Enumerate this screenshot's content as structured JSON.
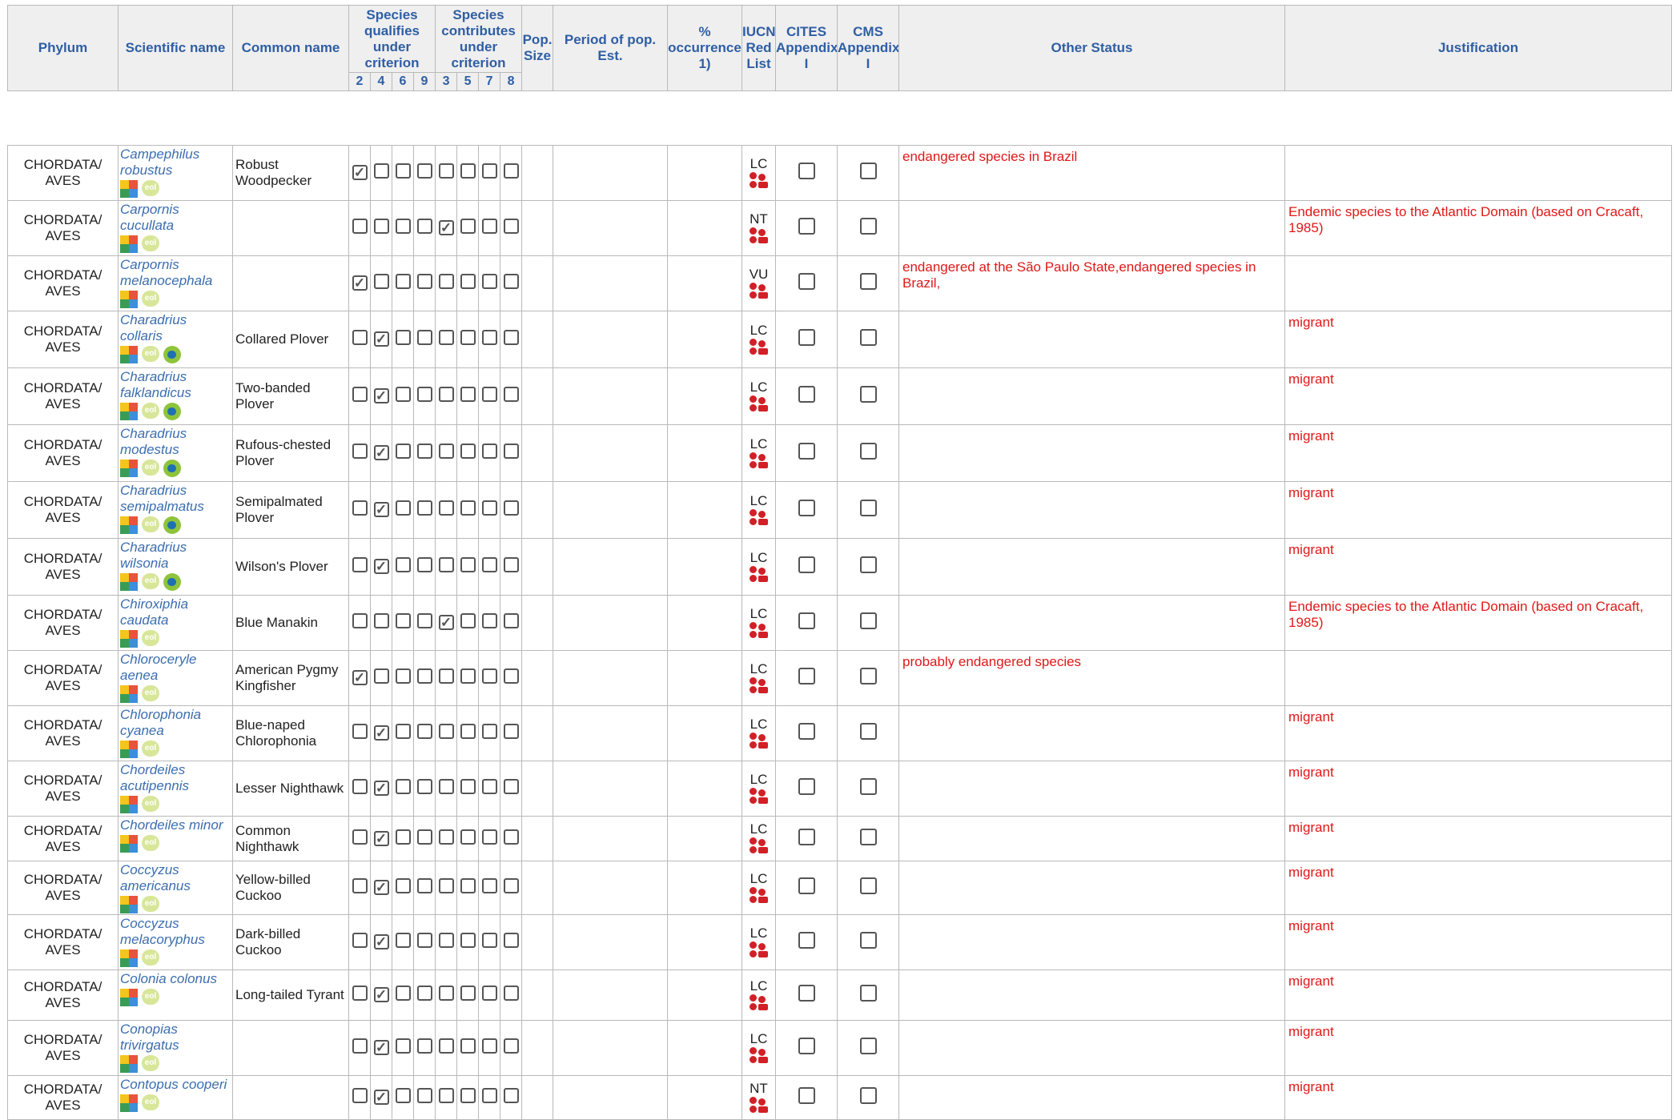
{
  "header": {
    "phylum": "Phylum",
    "scientific_name": "Scientific name",
    "common_name": "Common name",
    "qualifies": "Species qualifies under criterion",
    "contributes": "Species contributes under criterion",
    "pop_size": "Pop. Size",
    "period": "Period of pop. Est.",
    "occurrence": "% occurrence 1)",
    "iucn": "IUCN Red List",
    "cites": "CITES Appendix I",
    "cms": "CMS Appendix I",
    "other_status": "Other Status",
    "justification": "Justification",
    "qual_nums": [
      "2",
      "4",
      "6",
      "9"
    ],
    "contrib_nums": [
      "3",
      "5",
      "7",
      "8"
    ]
  },
  "rows": [
    {
      "phylum": "CHORDATA/ AVES",
      "sci": "Campephilus robustus",
      "common": "Robust Woodpecker",
      "checks": [
        1,
        0,
        0,
        0,
        0,
        0,
        0,
        0
      ],
      "iucn": "LC",
      "other": "endangered species in Brazil",
      "just": "",
      "bird": false
    },
    {
      "phylum": "CHORDATA/ AVES",
      "sci": "Carpornis cucullata",
      "common": "",
      "checks": [
        0,
        0,
        0,
        0,
        1,
        0,
        0,
        0
      ],
      "iucn": "NT",
      "other": "",
      "just": "Endemic species to the Atlantic Domain (based on Cracaft, 1985)",
      "bird": false
    },
    {
      "phylum": "CHORDATA/ AVES",
      "sci": "Carpornis melanocephala",
      "common": "",
      "checks": [
        1,
        0,
        0,
        0,
        0,
        0,
        0,
        0
      ],
      "iucn": "VU",
      "other": "endangered at the São Paulo State,endangered species in Brazil,",
      "just": "",
      "bird": false
    },
    {
      "phylum": "CHORDATA/ AVES",
      "sci": "Charadrius collaris",
      "common": "Collared Plover",
      "checks": [
        0,
        1,
        0,
        0,
        0,
        0,
        0,
        0
      ],
      "iucn": "LC",
      "other": "",
      "just": "migrant",
      "bird": true
    },
    {
      "phylum": "CHORDATA/ AVES",
      "sci": "Charadrius falklandicus",
      "common": "Two-banded Plover",
      "checks": [
        0,
        1,
        0,
        0,
        0,
        0,
        0,
        0
      ],
      "iucn": "LC",
      "other": "",
      "just": "migrant",
      "bird": true
    },
    {
      "phylum": "CHORDATA/ AVES",
      "sci": "Charadrius modestus",
      "common": "Rufous-chested Plover",
      "checks": [
        0,
        1,
        0,
        0,
        0,
        0,
        0,
        0
      ],
      "iucn": "LC",
      "other": "",
      "just": "migrant",
      "bird": true
    },
    {
      "phylum": "CHORDATA/ AVES",
      "sci": "Charadrius semipalmatus",
      "common": "Semipalmated Plover",
      "checks": [
        0,
        1,
        0,
        0,
        0,
        0,
        0,
        0
      ],
      "iucn": "LC",
      "other": "",
      "just": "migrant",
      "bird": true
    },
    {
      "phylum": "CHORDATA/ AVES",
      "sci": "Charadrius wilsonia",
      "common": "Wilson's Plover",
      "checks": [
        0,
        1,
        0,
        0,
        0,
        0,
        0,
        0
      ],
      "iucn": "LC",
      "other": "",
      "just": "migrant",
      "bird": true
    },
    {
      "phylum": "CHORDATA/ AVES",
      "sci": "Chiroxiphia caudata",
      "common": "Blue Manakin",
      "checks": [
        0,
        0,
        0,
        0,
        1,
        0,
        0,
        0
      ],
      "iucn": "LC",
      "other": "",
      "just": "Endemic species to the Atlantic Domain (based on Cracaft, 1985)",
      "bird": false
    },
    {
      "phylum": "CHORDATA/ AVES",
      "sci": "Chloroceryle aenea",
      "common": "American Pygmy Kingfisher",
      "checks": [
        1,
        0,
        0,
        0,
        0,
        0,
        0,
        0
      ],
      "iucn": "LC",
      "other": "probably endangered species",
      "just": "",
      "bird": false
    },
    {
      "phylum": "CHORDATA/ AVES",
      "sci": "Chlorophonia cyanea",
      "common": "Blue-naped Chlorophonia",
      "checks": [
        0,
        1,
        0,
        0,
        0,
        0,
        0,
        0
      ],
      "iucn": "LC",
      "other": "",
      "just": "migrant",
      "bird": false
    },
    {
      "phylum": "CHORDATA/ AVES",
      "sci": "Chordeiles acutipennis",
      "common": "Lesser Nighthawk",
      "checks": [
        0,
        1,
        0,
        0,
        0,
        0,
        0,
        0
      ],
      "iucn": "LC",
      "other": "",
      "just": "migrant",
      "bird": false
    },
    {
      "phylum": "CHORDATA/ AVES",
      "sci": "Chordeiles minor",
      "common": "Common Nighthawk",
      "checks": [
        0,
        1,
        0,
        0,
        0,
        0,
        0,
        0
      ],
      "iucn": "LC",
      "other": "",
      "just": "migrant",
      "bird": false
    },
    {
      "phylum": "CHORDATA/ AVES",
      "sci": "Coccyzus americanus",
      "common": "Yellow-billed Cuckoo",
      "checks": [
        0,
        1,
        0,
        0,
        0,
        0,
        0,
        0
      ],
      "iucn": "LC",
      "other": "",
      "just": "migrant",
      "bird": false
    },
    {
      "phylum": "CHORDATA/ AVES",
      "sci": "Coccyzus melacoryphus",
      "common": "Dark-billed Cuckoo",
      "checks": [
        0,
        1,
        0,
        0,
        0,
        0,
        0,
        0
      ],
      "iucn": "LC",
      "other": "",
      "just": "migrant",
      "bird": false
    },
    {
      "phylum": "CHORDATA/ AVES",
      "sci": "Colonia colonus",
      "common": "Long-tailed Tyrant",
      "checks": [
        0,
        1,
        0,
        0,
        0,
        0,
        0,
        0
      ],
      "iucn": "LC",
      "other": "",
      "just": "migrant",
      "bird": false
    },
    {
      "phylum": "CHORDATA/ AVES",
      "sci": "Conopias trivirgatus",
      "common": "",
      "checks": [
        0,
        1,
        0,
        0,
        0,
        0,
        0,
        0
      ],
      "iucn": "LC",
      "other": "",
      "just": "migrant",
      "bird": false
    },
    {
      "phylum": "CHORDATA/ AVES",
      "sci": "Contopus cooperi",
      "common": "",
      "checks": [
        0,
        1,
        0,
        0,
        0,
        0,
        0,
        0
      ],
      "iucn": "NT",
      "other": "",
      "just": "migrant",
      "bird": false
    }
  ],
  "icons": {
    "gbif": "gbif-icon",
    "eol": "eol-icon",
    "eol_text": "eol",
    "bird": "avibase-icon",
    "iucn": "iucn-logo-icon",
    "check": "✓"
  }
}
